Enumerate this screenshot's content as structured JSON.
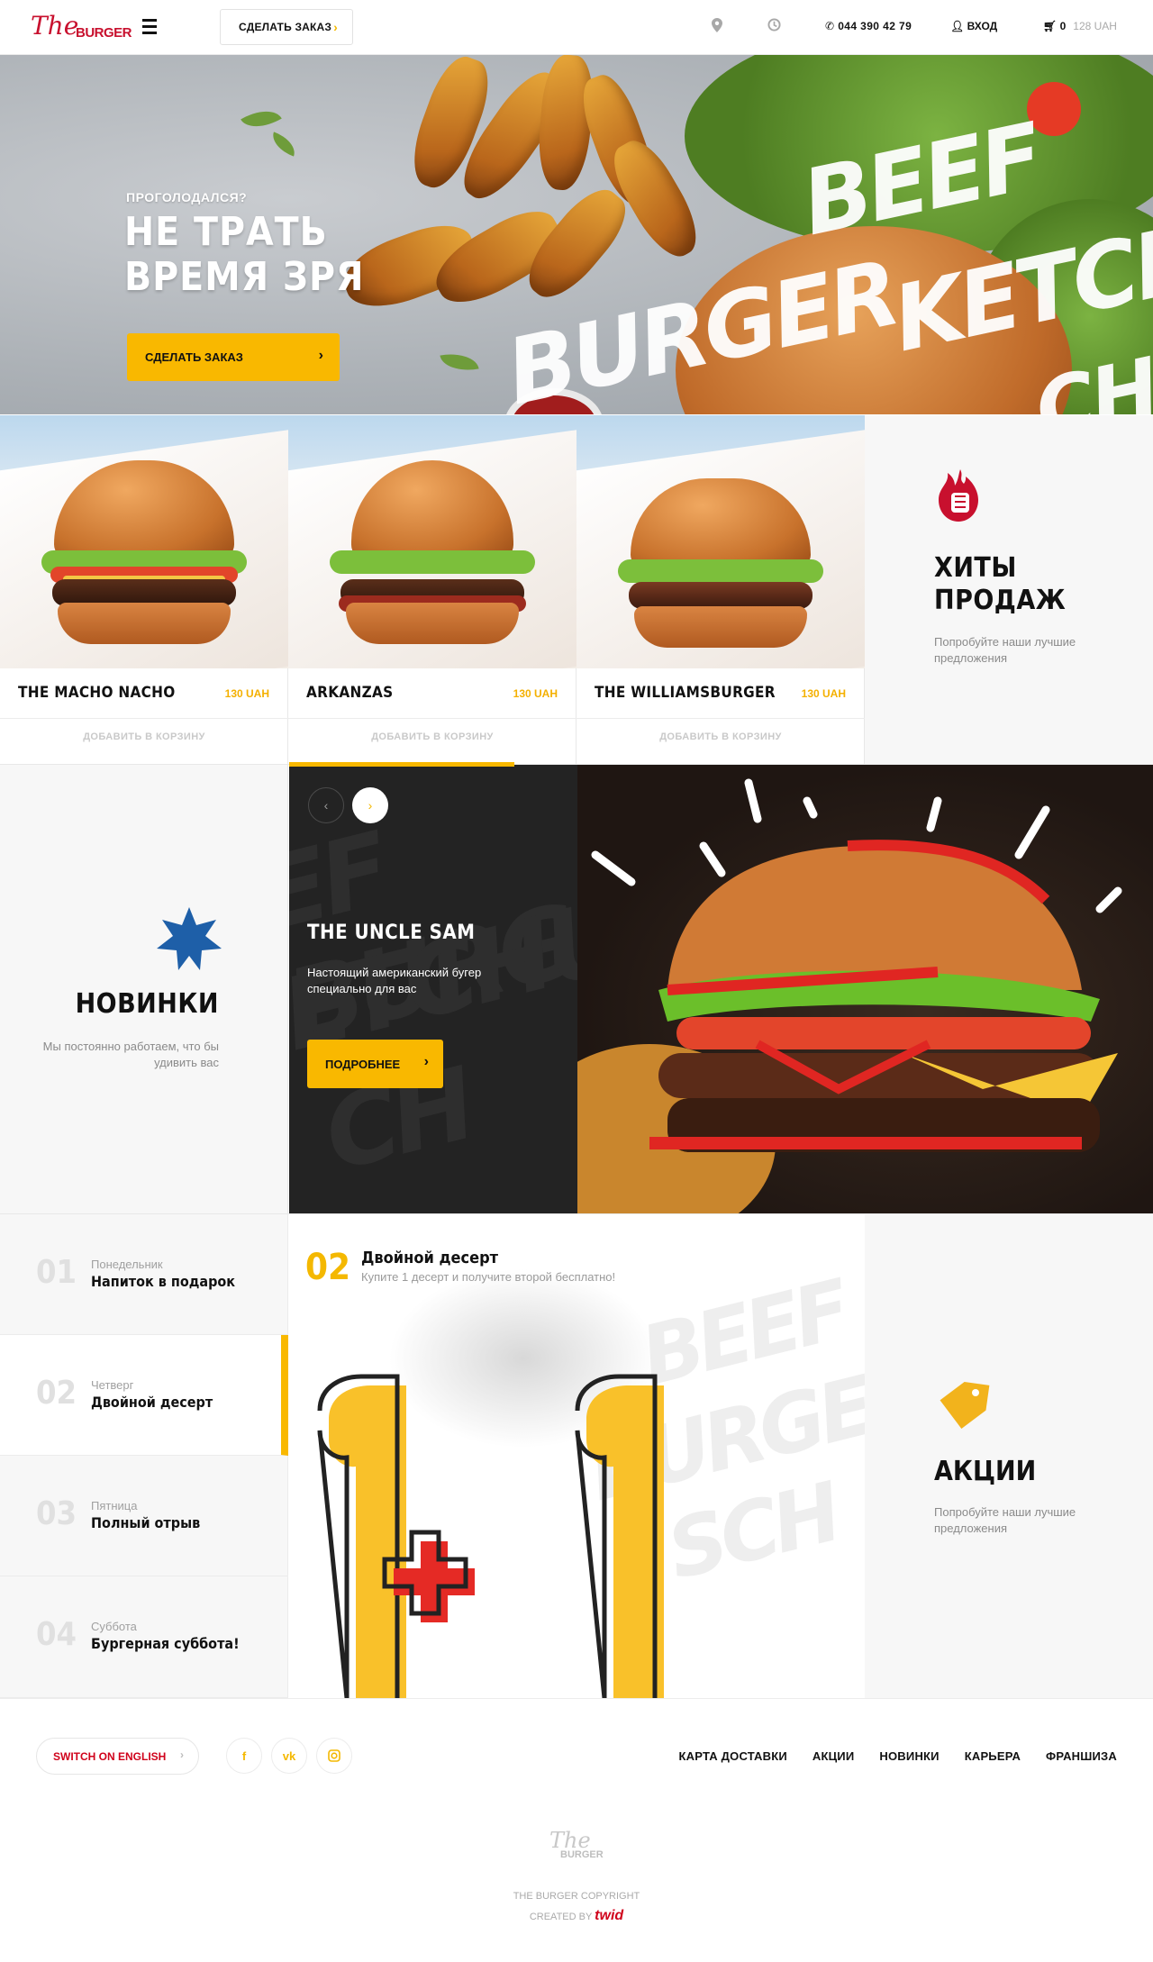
{
  "header": {
    "logo_the": "The",
    "logo_burger": "BURGER",
    "order_label": "СДЕЛАТЬ ЗАКАЗ",
    "phone": "044 390 42 79",
    "login": "ВХОД",
    "cart_count": "0",
    "cart_sum": "128 UAH",
    "icons": [
      "menu-icon",
      "location-pin-icon",
      "clock-icon",
      "phone-icon",
      "user-icon",
      "cart-icon"
    ]
  },
  "hero": {
    "subtitle": "ПРОГОЛОДАЛСЯ?",
    "title": "НЕ ТРАТЬ ВРЕМЯ ЗРЯ",
    "button": "СДЕЛАТЬ ЗАКАЗ",
    "brush_words": [
      "BEEF",
      "BURGER",
      "KETCH",
      "CH"
    ]
  },
  "products": [
    {
      "name": "THE MACHO NACHO",
      "price": "130 UAH",
      "add": "ДОБАВИТЬ В КОРЗИНУ"
    },
    {
      "name": "ARKANZAS",
      "price": "130 UAH",
      "add": "ДОБАВИТЬ В КОРЗИНУ"
    },
    {
      "name": "THE WILLIAMSBURGER",
      "price": "130 UAH",
      "add": "ДОБАВИТЬ В КОРЗИНУ"
    }
  ],
  "hits": {
    "title": "ХИТЫ ПРОДАЖ",
    "text": "Попробуйте наши лучшие предложения",
    "icon": "flame-fist-icon"
  },
  "news": {
    "title": "НОВИНКИ",
    "text": "Мы постоянно работаем, что бы удивить вас",
    "icon": "star-badge-icon"
  },
  "slider": {
    "title": "THE UNCLE SAM",
    "text": "Настоящий американский бугер специально для вас",
    "button": "ПОДРОБНЕЕ",
    "prev": "‹",
    "next": "›",
    "progress": 0.78
  },
  "days": [
    {
      "num": "01",
      "weekday": "Понедельник",
      "title": "Напиток в подарок",
      "active": false
    },
    {
      "num": "02",
      "weekday": "Четверг",
      "title": "Двойной десерт",
      "active": true
    },
    {
      "num": "03",
      "weekday": "Пятница",
      "title": "Полный отрыв",
      "active": false
    },
    {
      "num": "04",
      "weekday": "Суббота",
      "title": "Бургерная суббота!",
      "active": false
    }
  ],
  "promo": {
    "num": "02",
    "title": "Двойной десерт",
    "text": "Купите 1 десерт и получите второй бесплатно!"
  },
  "actions": {
    "title": "АКЦИИ",
    "text": "Попробуйте наши лучшие предложения",
    "icon": "price-tag-icon"
  },
  "footer": {
    "lang": "SWITCH ON ENGLISH",
    "social": [
      "f",
      "vk",
      "ig"
    ],
    "nav": [
      "КАРТА ДОСТАВКИ",
      "АКЦИИ",
      "НОВИНКИ",
      "КАРЬЕРА",
      "ФРАНШИЗА"
    ],
    "copyright": "THE BURGER COPYRIGHT",
    "created_by": "CREATED BY",
    "studio": "twid"
  },
  "colors": {
    "accent": "#f9b800",
    "brand_red": "#c8102e",
    "dark": "#232323",
    "light_bg": "#f7f7f7"
  }
}
